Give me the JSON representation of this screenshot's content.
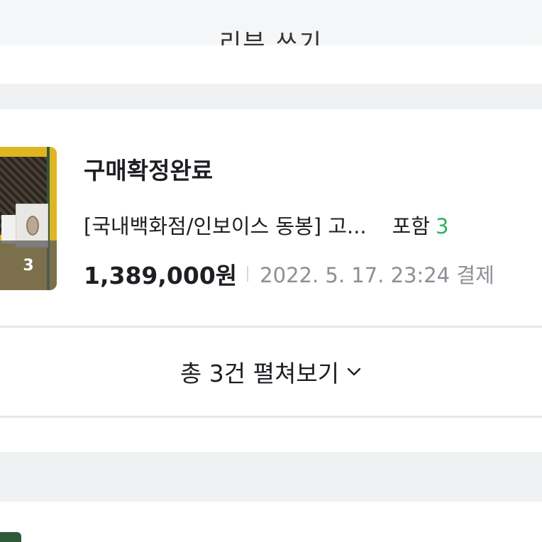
{
  "top_button": {
    "label": "리뷰 쓰기"
  },
  "order": {
    "thumbnail_count": "3",
    "status": "구매확정완료",
    "product_name": "[국내백화점/인보이스 동봉] 고...",
    "included_label": "포함",
    "included_count": "3",
    "price": "1,389,000원",
    "payment_date": "2022. 5. 17. 23:24 결제"
  },
  "expand": {
    "label": "총 3건 펼쳐보기"
  },
  "colors": {
    "accent_green": "#2db45b",
    "text_primary": "#1e1e23",
    "text_secondary": "#8d8f96",
    "section_gap": "#f0f1f3"
  }
}
